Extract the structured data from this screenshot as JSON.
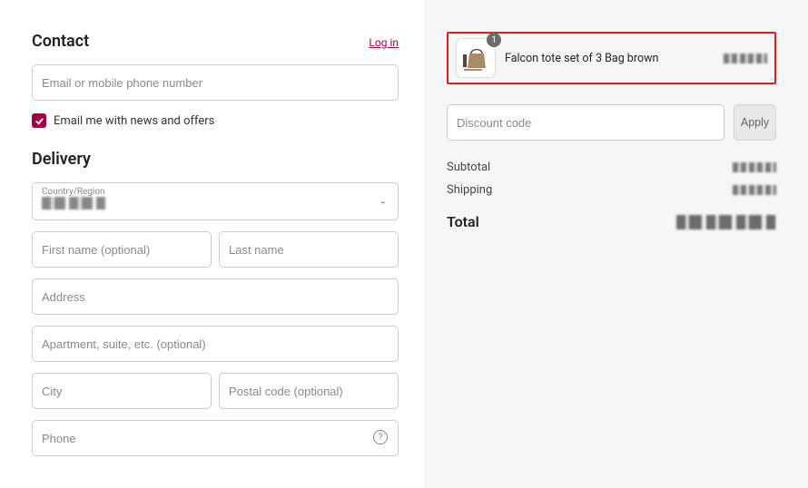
{
  "contact": {
    "heading": "Contact",
    "login_label": "Log in",
    "email_placeholder": "Email or mobile phone number",
    "news_checkbox_label": "Email me with news and offers"
  },
  "delivery": {
    "heading": "Delivery",
    "country_label": "Country/Region",
    "first_name_placeholder": "First name (optional)",
    "last_name_placeholder": "Last name",
    "address_placeholder": "Address",
    "apartment_placeholder": "Apartment, suite, etc. (optional)",
    "city_placeholder": "City",
    "postal_placeholder": "Postal code (optional)",
    "phone_placeholder": "Phone"
  },
  "cart": {
    "item": {
      "qty": "1",
      "name": "Falcon tote set of 3 Bag brown"
    },
    "discount_placeholder": "Discount code",
    "apply_label": "Apply",
    "subtotal_label": "Subtotal",
    "shipping_label": "Shipping",
    "total_label": "Total"
  },
  "colors": {
    "accent": "#a10046",
    "highlight_border": "#e1201a"
  }
}
